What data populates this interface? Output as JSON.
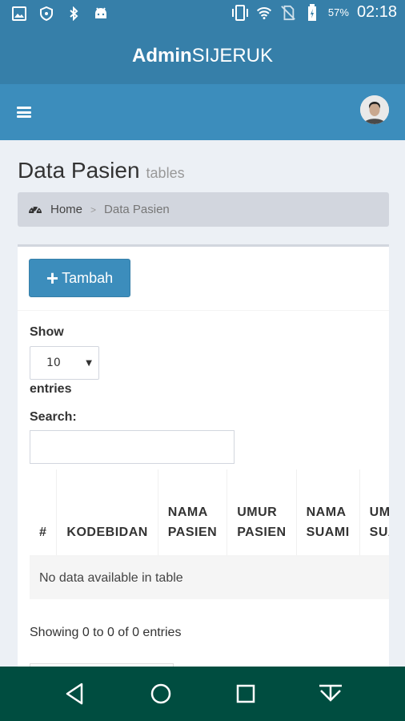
{
  "status_bar": {
    "icons": [
      "image-icon",
      "shield-icon",
      "bluetooth-icon",
      "android-icon"
    ],
    "battery_pct": "57%",
    "time": "02:18"
  },
  "app": {
    "logo_bold": "Admin",
    "logo_light": "SIJERUK"
  },
  "header": {
    "title": "Data Pasien",
    "subtitle": "tables"
  },
  "breadcrumb": {
    "home": "Home",
    "separator": ">",
    "current": "Data Pasien"
  },
  "toolbar": {
    "add_label": "Tambah"
  },
  "datatable": {
    "show_label": "Show",
    "entries_value": "10",
    "entries_label": "entries",
    "search_label": "Search:",
    "search_value": "",
    "columns": [
      "#",
      "KODEBIDAN",
      "NAMA PASIEN",
      "UMUR PASIEN",
      "NAMA SUAMI",
      "UMUR SUAMI"
    ],
    "empty_message": "No data available in table",
    "info": "Showing 0 to 0 of 0 entries"
  },
  "colors": {
    "primary": "#3c8dbc",
    "primary_dark": "#367fa9",
    "nav_bar": "#004d40"
  }
}
